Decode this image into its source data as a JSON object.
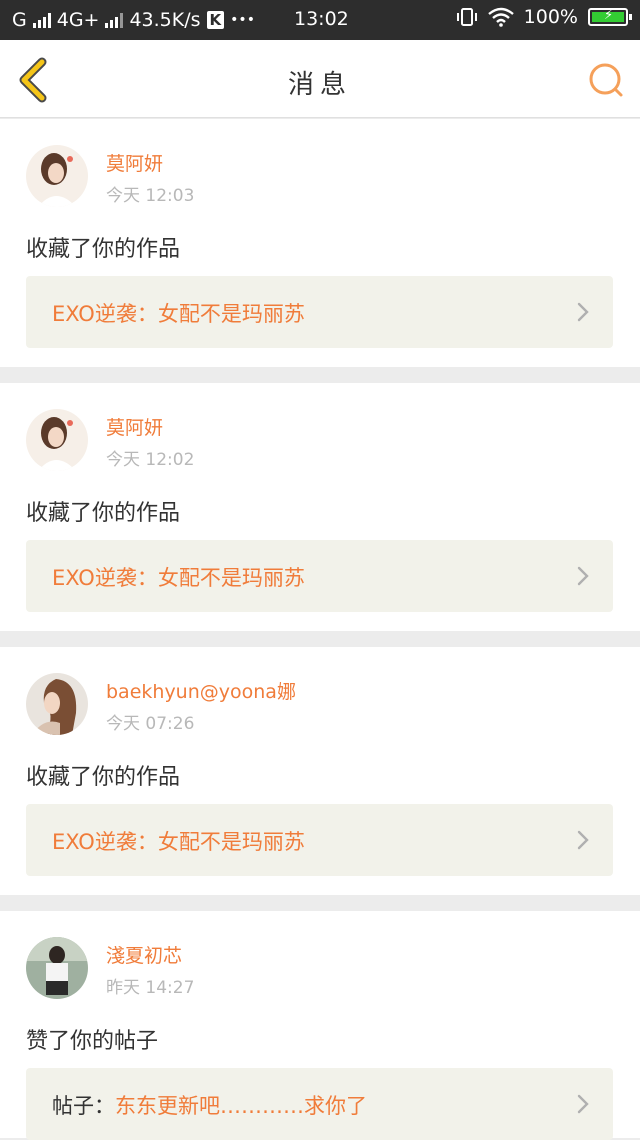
{
  "status_bar": {
    "network_type": "G",
    "network_type2": "4G+",
    "speed": "43.5K/s",
    "app_badge": "K",
    "dots": "•••",
    "time": "13:02",
    "battery": "100%"
  },
  "header": {
    "title": "消息"
  },
  "notifications": [
    {
      "username": "莫阿妍",
      "time": "今天 12:03",
      "action": "收藏了你的作品",
      "ref_prefix": "",
      "ref_title": "EXO逆袭：女配不是玛丽苏"
    },
    {
      "username": "莫阿妍",
      "time": "今天 12:02",
      "action": "收藏了你的作品",
      "ref_prefix": "",
      "ref_title": "EXO逆袭：女配不是玛丽苏"
    },
    {
      "username": "baekhyun@yoona娜",
      "time": "今天 07:26",
      "action": "收藏了你的作品",
      "ref_prefix": "",
      "ref_title": "EXO逆袭：女配不是玛丽苏"
    },
    {
      "username": "淺夏初芯",
      "time": "昨天 14:27",
      "action": "赞了你的帖子",
      "ref_prefix": "帖子：",
      "ref_title": "东东更新吧…………求你了"
    }
  ],
  "colors": {
    "accent": "#f07c3a",
    "back_arrow": "#f5c518",
    "ref_bg": "#f2f2ea"
  }
}
